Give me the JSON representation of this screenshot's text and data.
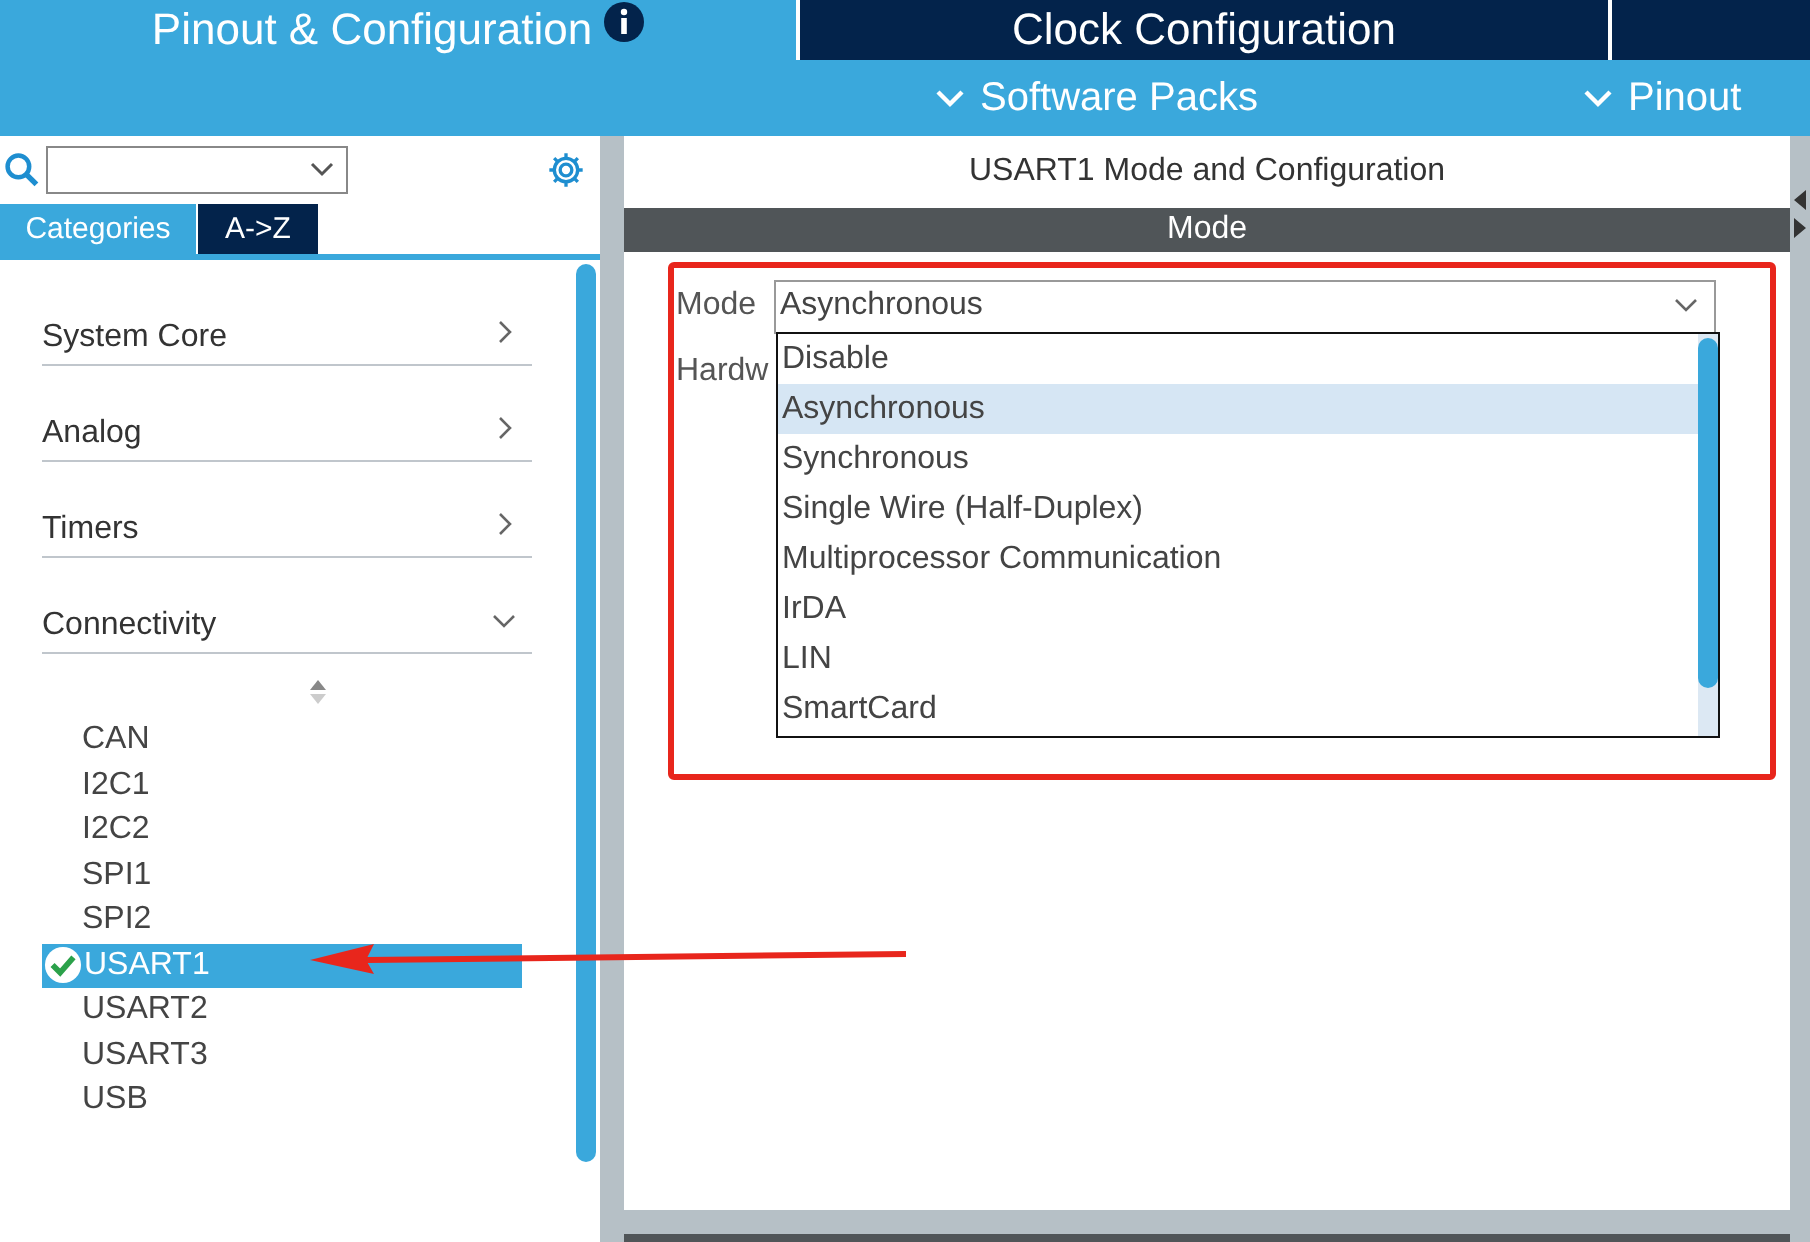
{
  "top_tabs": [
    {
      "label": "Pinout & Configuration",
      "selected": true,
      "info": true
    },
    {
      "label": "Clock Configuration",
      "selected": false,
      "info": false
    },
    {
      "selected": false,
      "info": false
    }
  ],
  "sub_menu": [
    "Software Packs",
    "Pinout"
  ],
  "sidebar": {
    "view_tabs": [
      {
        "label": "Categories",
        "selected": true
      },
      {
        "label": "A->Z",
        "selected": false
      }
    ],
    "categories": [
      {
        "label": "System Core",
        "expanded": false
      },
      {
        "label": "Analog",
        "expanded": false
      },
      {
        "label": "Timers",
        "expanded": false
      },
      {
        "label": "Connectivity",
        "expanded": true,
        "children": [
          {
            "label": "CAN",
            "selected": false,
            "enabled": false
          },
          {
            "label": "I2C1",
            "selected": false,
            "enabled": false
          },
          {
            "label": "I2C2",
            "selected": false,
            "enabled": false
          },
          {
            "label": "SPI1",
            "selected": false,
            "enabled": false
          },
          {
            "label": "SPI2",
            "selected": false,
            "enabled": false
          },
          {
            "label": "USART1",
            "selected": true,
            "enabled": true
          },
          {
            "label": "USART2",
            "selected": false,
            "enabled": false
          },
          {
            "label": "USART3",
            "selected": false,
            "enabled": false
          },
          {
            "label": "USB",
            "selected": false,
            "enabled": false
          }
        ]
      }
    ]
  },
  "panel": {
    "title": "USART1 Mode and Configuration",
    "section": "Mode",
    "mode_label": "Mode",
    "mode_value": "Asynchronous",
    "hidden_label": "Hardw",
    "options": [
      {
        "label": "Disable",
        "selected": false
      },
      {
        "label": "Asynchronous",
        "selected": true
      },
      {
        "label": "Synchronous",
        "selected": false
      },
      {
        "label": "Single Wire (Half-Duplex)",
        "selected": false
      },
      {
        "label": "Multiprocessor Communication",
        "selected": false
      },
      {
        "label": "IrDA",
        "selected": false
      },
      {
        "label": "LIN",
        "selected": false
      },
      {
        "label": "SmartCard",
        "selected": false
      }
    ]
  }
}
